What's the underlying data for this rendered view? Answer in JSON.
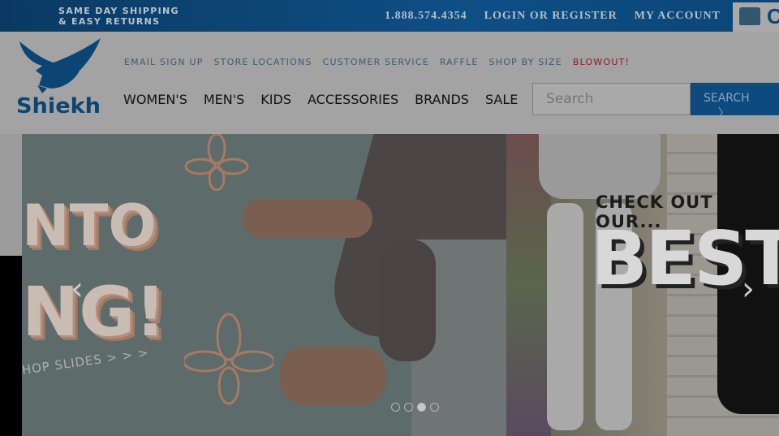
{
  "topbar": {
    "promo_line1": "SAME DAY SHIPPING",
    "promo_line2": "& EASY RETURNS",
    "phone": "1.888.574.4354",
    "login": "LOGIN OR REGISTER",
    "account": "MY ACCOUNT",
    "cart_letter": "C"
  },
  "brand": {
    "logo_text": "Shiekh"
  },
  "utility_nav": [
    "EMAIL SIGN UP",
    "STORE LOCATIONS",
    "CUSTOMER SERVICE",
    "RAFFLE",
    "SHOP BY SIZE",
    "BLOWOUT!"
  ],
  "main_nav": [
    "WOMEN'S",
    "MEN'S",
    "KIDS",
    "ACCESSORIES",
    "BRANDS",
    "SALE"
  ],
  "search": {
    "placeholder": "Search",
    "button": "SEARCH"
  },
  "carousel": {
    "slide1": {
      "line1": "NTO",
      "line2": "NG!",
      "cta": "HOP SLIDES > > >"
    },
    "slide2": {
      "line1": "CHECK OUT OUR...",
      "line2": "BEST"
    },
    "slide_count": 4,
    "active_slide": 3
  },
  "colors": {
    "brand_blue": "#0e4f85",
    "blowout_red": "#8f1a24"
  }
}
